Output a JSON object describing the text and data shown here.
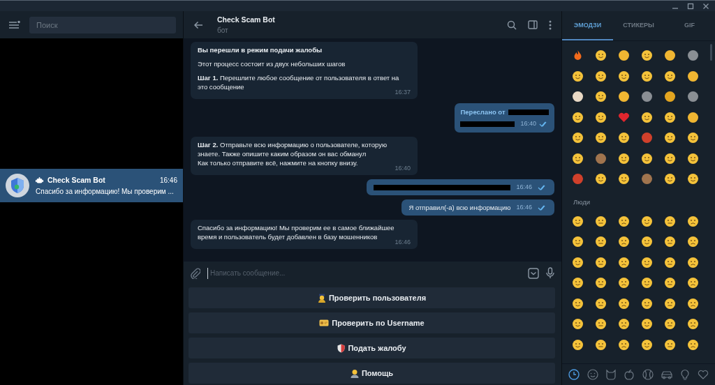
{
  "sidebar": {
    "search": {
      "placeholder": "Поиск"
    },
    "chats": [
      {
        "name": "Check Scam Bot",
        "time": "16:46",
        "preview": "Спасибо за информацию! Мы проверим ...",
        "selected": true
      }
    ]
  },
  "chat": {
    "title": "Check Scam Bot",
    "subtitle": "бот",
    "messages": [
      {
        "kind": "incoming",
        "paragraphs": [
          {
            "text": "Вы перешли в режим подачи жалобы",
            "bold": true
          },
          {
            "text": "Этот процесс состоит из двух небольших шагов",
            "bold": false
          },
          {
            "text": "**Шаг 1.** Перешлите любое сообщение от пользователя в ответ на это сообщение",
            "bold": false
          }
        ],
        "time": "16:37"
      },
      {
        "kind": "forwarded",
        "label": "Переслано от",
        "time": "16:40",
        "read": true
      },
      {
        "kind": "incoming",
        "paragraphs": [
          {
            "text": "**Шаг 2.** Отправьте всю информацию о пользователе, которую знаете. Также опишите каким образом он вас обманул\nКак только отправите всё, нажмите на кнопку внизу.",
            "bold": false
          }
        ],
        "time": "16:40"
      },
      {
        "kind": "redacted",
        "time": "16:46",
        "read": true
      },
      {
        "kind": "outgoing",
        "text": "Я отправил(-а) всю информацию",
        "time": "16:46",
        "read": true
      },
      {
        "kind": "incoming",
        "paragraphs": [
          {
            "text": "Спасибо за информацию! Мы проверим ее в самое ближайшее время и пользователь будет добавлен в базу мошенников",
            "bold": false
          }
        ],
        "time": "16:46"
      }
    ],
    "composer": {
      "placeholder": "Написать сообщение..."
    },
    "keyboard": [
      {
        "kind": "officer",
        "label": "Проверить пользователя"
      },
      {
        "kind": "card",
        "label": "Проверить по Username"
      },
      {
        "kind": "shield",
        "label": "Подать жалобу"
      },
      {
        "kind": "person",
        "label": "Помощь"
      }
    ]
  },
  "emoji_panel": {
    "tabs": [
      {
        "label": "ЭМОДЗИ",
        "selected": true
      },
      {
        "label": "СТИКЕРЫ",
        "selected": false
      },
      {
        "label": "GIF",
        "selected": false
      }
    ],
    "section": "Люди",
    "categories": [
      {
        "kind": "clock",
        "selected": true
      },
      {
        "kind": "smile",
        "selected": false
      },
      {
        "kind": "cat",
        "selected": false
      },
      {
        "kind": "apple",
        "selected": false
      },
      {
        "kind": "ball",
        "selected": false
      },
      {
        "kind": "car",
        "selected": false
      },
      {
        "kind": "bulb",
        "selected": false
      },
      {
        "kind": "heart",
        "selected": false
      }
    ]
  }
}
